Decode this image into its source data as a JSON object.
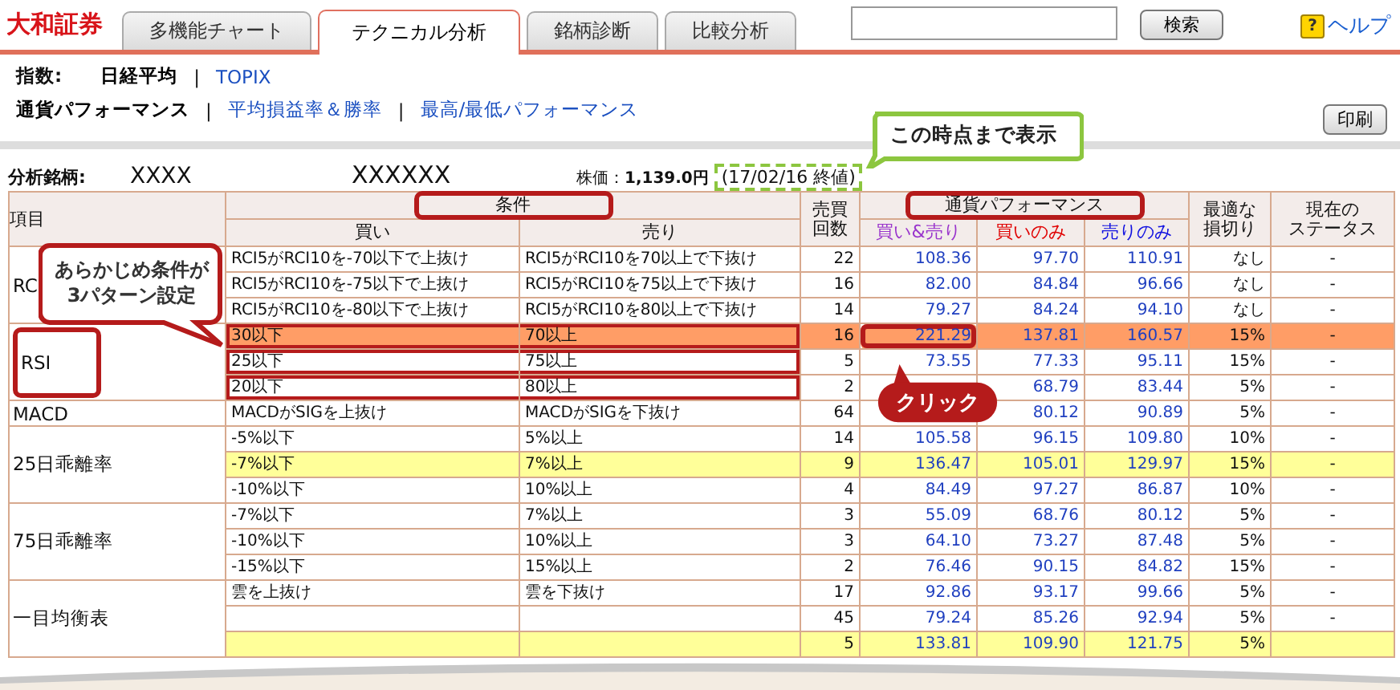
{
  "brand": "大和証券",
  "tabs": [
    {
      "label": "多機能チャート",
      "selected": false
    },
    {
      "label": "テクニカル分析",
      "selected": true
    },
    {
      "label": "銘柄診断",
      "selected": false
    },
    {
      "label": "比較分析",
      "selected": false
    }
  ],
  "search": {
    "button": "検索"
  },
  "help": {
    "icon": "?",
    "label": "ヘルプ"
  },
  "index_row": {
    "label": "指数:",
    "separators": [
      "|"
    ],
    "items": [
      {
        "label": "日経平均",
        "selected": true
      },
      {
        "label": "TOPIX",
        "selected": false
      }
    ]
  },
  "view_row": {
    "separators": [
      "|",
      "|"
    ],
    "items": [
      {
        "label": "通貨パフォーマンス",
        "selected": true
      },
      {
        "label": "平均損益率＆勝率",
        "selected": false
      },
      {
        "label": "最高/最低パフォーマンス",
        "selected": false
      }
    ]
  },
  "print_button": "印刷",
  "stock": {
    "label": "分析銘柄:",
    "code": "XXXX",
    "name": "XXXXXX",
    "price_label": "株価：",
    "price": "1,139.0円",
    "date": "(17/02/16 終値)"
  },
  "callouts": [
    {
      "kind": "note",
      "lines": [
        "この時点まで表示"
      ]
    },
    {
      "kind": "speech",
      "lines": [
        "あらかじめ条件が",
        "3パターン設定"
      ]
    },
    {
      "kind": "click",
      "lines": [
        "クリック"
      ]
    }
  ],
  "header": {
    "item": "項目",
    "conditions": {
      "label": "条件",
      "outlined": true
    },
    "buy": "買い",
    "sell": "売り",
    "trades": [
      "売買",
      "回数"
    ],
    "performance": {
      "label": "通貨パフォーマンス",
      "outlined": true
    },
    "perf_columns": [
      {
        "label": "買い&売り",
        "color": "#9933cc"
      },
      {
        "label": "買いのみ",
        "color": "#e00000"
      },
      {
        "label": "売りのみ",
        "color": "#1010e0"
      }
    ],
    "stop_loss": [
      "最適な",
      "損切り"
    ],
    "status": [
      "現在の",
      "ステータス"
    ]
  },
  "groups": [
    {
      "item": "RC",
      "outlined": false,
      "rows": [
        {
          "buy": "RCI5がRCI10を-70以下で上抜け",
          "sell": "RCI5がRCI10を70以上で下抜け",
          "trades": "22",
          "both": "108.36",
          "buy_only": "97.70",
          "sell_only": "110.91",
          "stop_loss": "なし",
          "status": "-",
          "selected": false,
          "recommended": false,
          "outlined": false,
          "clicked": false
        },
        {
          "buy": "RCI5がRCI10を-75以下で上抜け",
          "sell": "RCI5がRCI10を75以上で下抜け",
          "trades": "16",
          "both": "82.00",
          "buy_only": "84.84",
          "sell_only": "96.66",
          "stop_loss": "なし",
          "status": "-",
          "selected": false,
          "recommended": false,
          "outlined": false,
          "clicked": false
        },
        {
          "buy": "RCI5がRCI10を-80以下で上抜け",
          "sell": "RCI5がRCI10を80以上で下抜け",
          "trades": "14",
          "both": "79.27",
          "buy_only": "84.24",
          "sell_only": "94.10",
          "stop_loss": "なし",
          "status": "-",
          "selected": false,
          "recommended": false,
          "outlined": false,
          "clicked": false
        }
      ]
    },
    {
      "item": "RSI",
      "outlined": true,
      "rows": [
        {
          "buy": "30以下",
          "sell": "70以上",
          "trades": "16",
          "both": "221.29",
          "buy_only": "137.81",
          "sell_only": "160.57",
          "stop_loss": "15%",
          "status": "-",
          "selected": true,
          "recommended": false,
          "outlined": true,
          "clicked": true
        },
        {
          "buy": "25以下",
          "sell": "75以上",
          "trades": "5",
          "both": "73.55",
          "buy_only": "77.33",
          "sell_only": "95.11",
          "stop_loss": "15%",
          "status": "-",
          "selected": false,
          "recommended": false,
          "outlined": true,
          "clicked": false
        },
        {
          "buy": "20以下",
          "sell": "80以上",
          "trades": "2",
          "buy_only": "68.79",
          "sell_only": "83.44",
          "stop_loss": "5%",
          "status": "-",
          "selected": false,
          "recommended": false,
          "outlined": true,
          "clicked": false
        }
      ]
    },
    {
      "item": "MACD",
      "outlined": false,
      "rows": [
        {
          "buy": "MACDがSIGを上抜け",
          "sell": "MACDがSIGを下抜け",
          "trades": "64",
          "buy_only": "80.12",
          "sell_only": "90.89",
          "stop_loss": "5%",
          "status": "-",
          "selected": false,
          "recommended": false,
          "outlined": false,
          "clicked": false
        }
      ]
    },
    {
      "item": "25日乖離率",
      "outlined": false,
      "rows": [
        {
          "buy": "-5%以下",
          "sell": "5%以上",
          "trades": "14",
          "both": "105.58",
          "buy_only": "96.15",
          "sell_only": "109.80",
          "stop_loss": "10%",
          "status": "-",
          "selected": false,
          "recommended": false,
          "outlined": false,
          "clicked": false
        },
        {
          "buy": "-7%以下",
          "sell": "7%以上",
          "trades": "9",
          "both": "136.47",
          "buy_only": "105.01",
          "sell_only": "129.97",
          "stop_loss": "15%",
          "status": "-",
          "selected": false,
          "recommended": true,
          "outlined": false,
          "clicked": false
        },
        {
          "buy": "-10%以下",
          "sell": "10%以上",
          "trades": "4",
          "both": "84.49",
          "buy_only": "97.27",
          "sell_only": "86.87",
          "stop_loss": "10%",
          "status": "-",
          "selected": false,
          "recommended": false,
          "outlined": false,
          "clicked": false
        }
      ]
    },
    {
      "item": "75日乖離率",
      "outlined": false,
      "rows": [
        {
          "buy": "-7%以下",
          "sell": "7%以上",
          "trades": "3",
          "both": "55.09",
          "buy_only": "68.76",
          "sell_only": "80.12",
          "stop_loss": "5%",
          "status": "-",
          "selected": false,
          "recommended": false,
          "outlined": false,
          "clicked": false
        },
        {
          "buy": "-10%以下",
          "sell": "10%以上",
          "trades": "3",
          "both": "64.10",
          "buy_only": "73.27",
          "sell_only": "87.48",
          "stop_loss": "5%",
          "status": "-",
          "selected": false,
          "recommended": false,
          "outlined": false,
          "clicked": false
        },
        {
          "buy": "-15%以下",
          "sell": "15%以上",
          "trades": "2",
          "both": "76.46",
          "buy_only": "90.15",
          "sell_only": "84.82",
          "stop_loss": "15%",
          "status": "-",
          "selected": false,
          "recommended": false,
          "outlined": false,
          "clicked": false
        }
      ]
    },
    {
      "item": "一目均衡表",
      "outlined": false,
      "rows": [
        {
          "buy": "雲を上抜け",
          "sell": "雲を下抜け",
          "trades": "17",
          "both": "92.86",
          "buy_only": "93.17",
          "sell_only": "99.66",
          "stop_loss": "5%",
          "status": "-",
          "selected": false,
          "recommended": false,
          "outlined": false,
          "clicked": false
        },
        {
          "trades": "45",
          "both": "79.24",
          "buy_only": "85.26",
          "sell_only": "92.94",
          "stop_loss": "5%",
          "status": "-",
          "selected": false,
          "recommended": false,
          "outlined": false,
          "clicked": false
        },
        {
          "trades": "5",
          "both": "133.81",
          "buy_only": "109.90",
          "sell_only": "121.75",
          "stop_loss": "5%",
          "selected": false,
          "recommended": true,
          "outlined": false,
          "clicked": false
        }
      ]
    }
  ]
}
